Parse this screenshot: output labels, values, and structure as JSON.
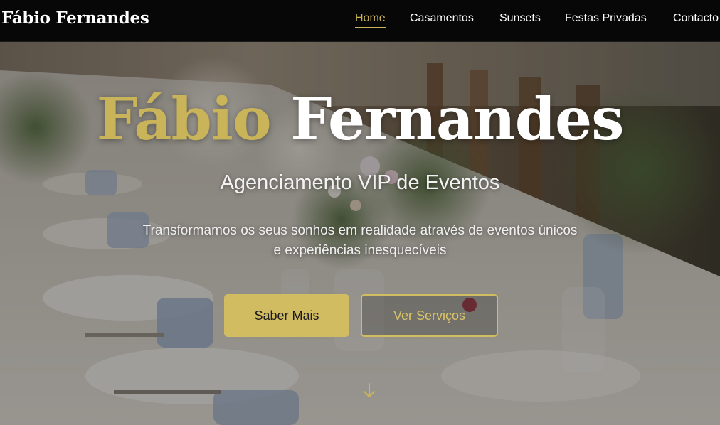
{
  "header": {
    "brand": "Fábio Fernandes",
    "nav": [
      {
        "label": "Home",
        "active": true
      },
      {
        "label": "Casamentos",
        "active": false
      },
      {
        "label": "Sunsets",
        "active": false
      },
      {
        "label": "Festas Privadas",
        "active": false
      },
      {
        "label": "Contacto",
        "active": false
      }
    ]
  },
  "hero": {
    "title_first": "Fábio",
    "title_second": "Fernandes",
    "subtitle": "Agenciamento VIP de Eventos",
    "description": "Transformamos os seus sonhos em realidade através de eventos únicos e experiências inesquecíveis",
    "primary_button": "Saber Mais",
    "secondary_button": "Ver Serviços",
    "scroll_icon": "arrow-down-icon",
    "background_image": "banquet-table-with-flowers-photo"
  },
  "colors": {
    "accent_gold": "#c9b45a",
    "header_bg": "#070707",
    "text_white": "#ffffff"
  }
}
